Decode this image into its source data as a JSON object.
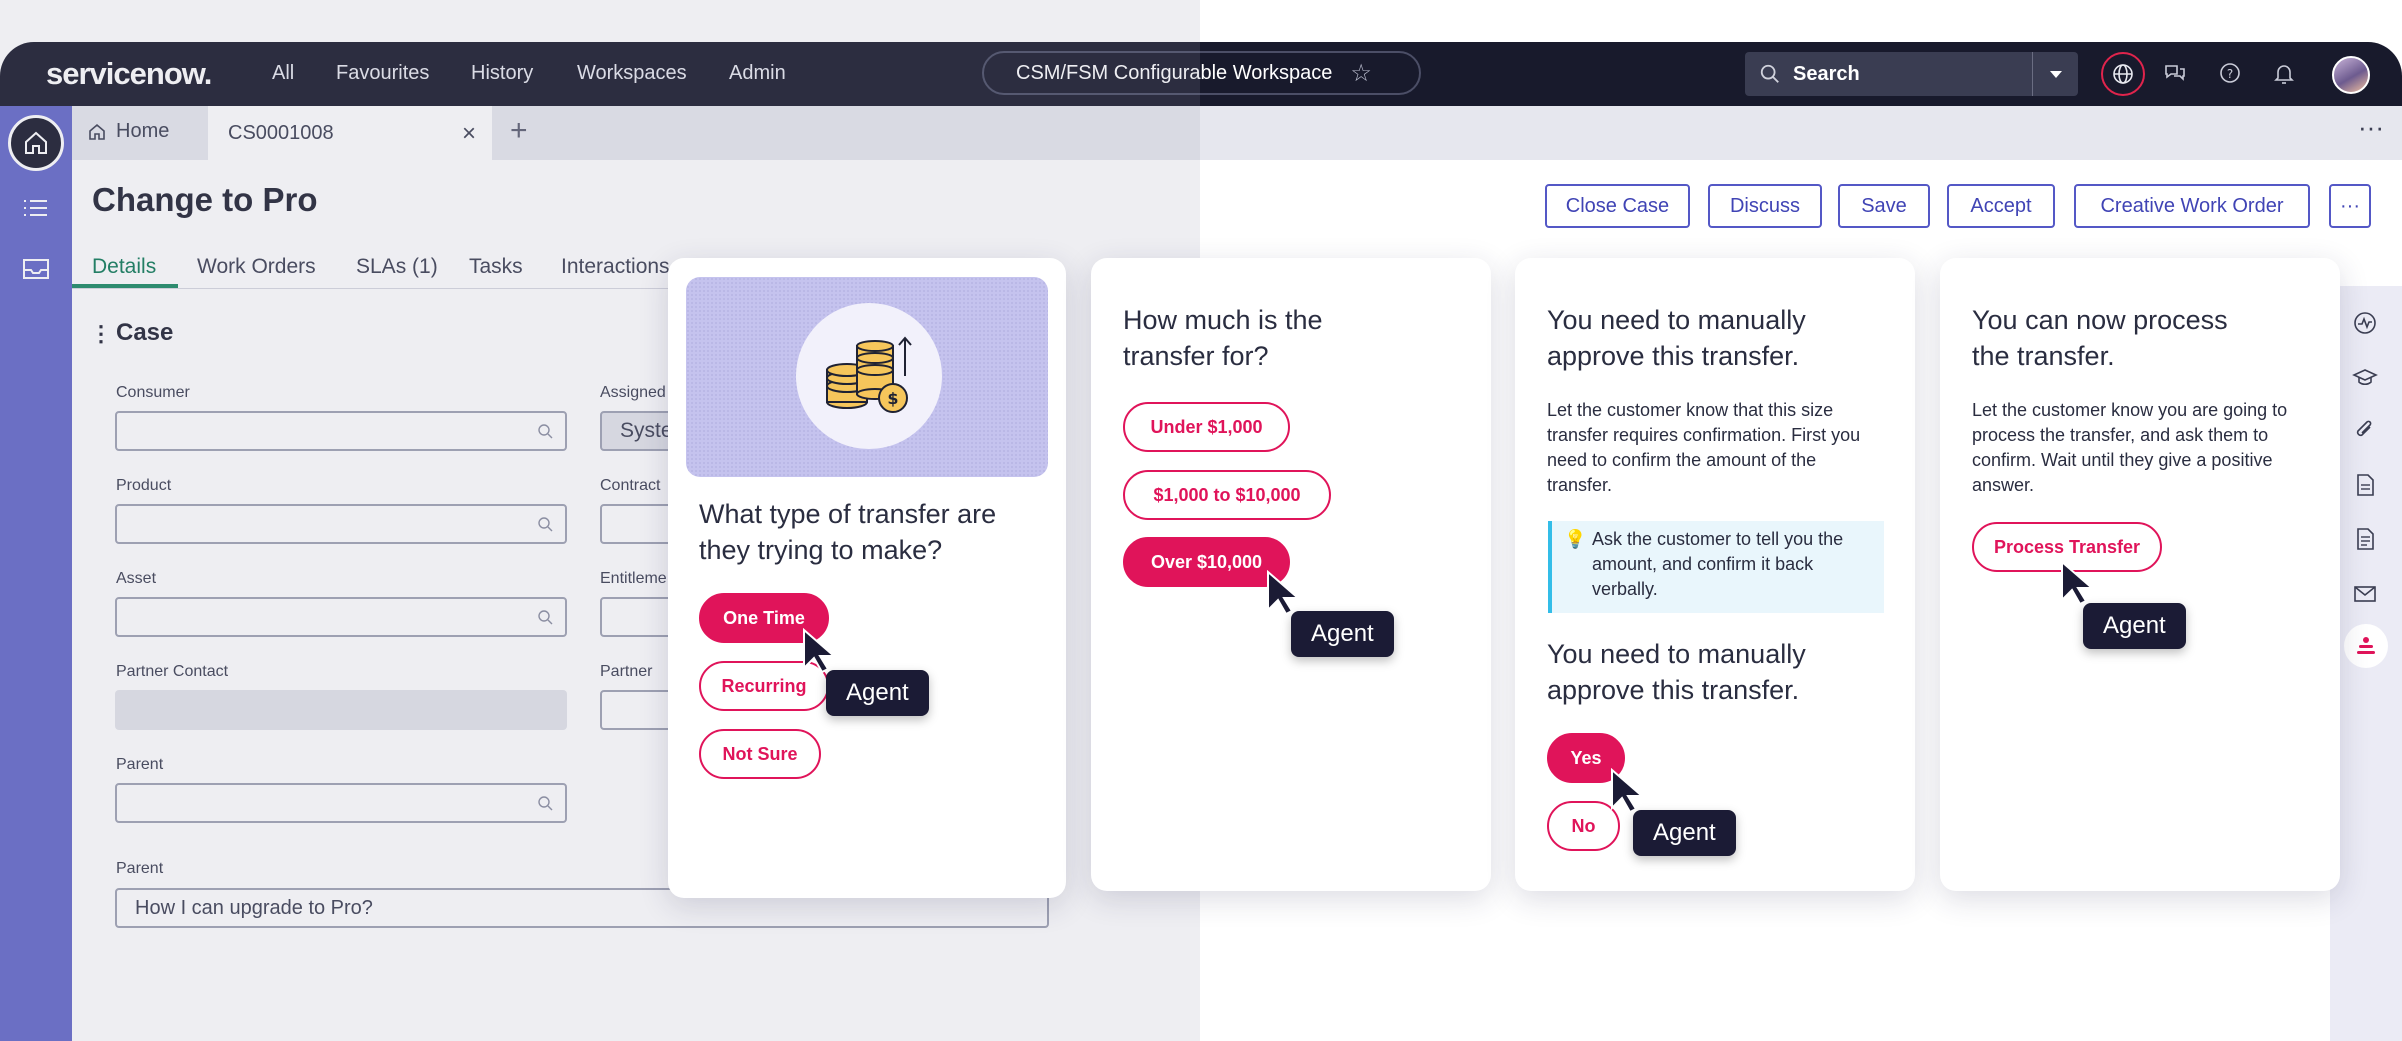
{
  "topnav": {
    "logo": "servicenow.",
    "items": [
      "All",
      "Favourites",
      "History",
      "Workspaces",
      "Admin"
    ],
    "workspace_title": "CSM/FSM Configurable Workspace",
    "search_label": "Search"
  },
  "tabs": {
    "home": "Home",
    "case": "CS0001008",
    "close": "×",
    "add": "+",
    "more": "···"
  },
  "record": {
    "title": "Change to Pro",
    "actions": [
      "Close Case",
      "Discuss",
      "Save",
      "Accept",
      "Creative Work Order"
    ],
    "more": "···",
    "subtabs": [
      "Details",
      "Work Orders",
      "SLAs (1)",
      "Tasks",
      "Interactions"
    ]
  },
  "form": {
    "section_title": "Case",
    "kebab": "⋮",
    "labels_left": [
      "Consumer",
      "Product",
      "Asset",
      "Partner Contact",
      "Parent"
    ],
    "labels_right": [
      "Assigned",
      "Contract",
      "Entitleme",
      "Partner"
    ],
    "assigned_value": "Syste",
    "parent2_label": "Parent",
    "parent2_value": "How I can upgrade to Pro?"
  },
  "card1": {
    "question": "What type of transfer are they trying to make?",
    "options": [
      "One Time",
      "Recurring",
      "Not Sure"
    ]
  },
  "card2": {
    "question": "How much is the transfer for?",
    "options": [
      "Under $1,000",
      "$1,000 to $10,000",
      "Over $10,000"
    ]
  },
  "card3": {
    "heading": "You need to manually approve this transfer.",
    "body": "Let the customer know that this size transfer requires confirmation. First you need to confirm the amount of the transfer.",
    "tip": "Ask the customer to tell you the amount, and confirm it back verbally.",
    "heading2": "You need to manually approve this transfer.",
    "options": [
      "Yes",
      "No"
    ]
  },
  "card4": {
    "heading": "You can now process the transfer.",
    "body": "Let the customer know you are going to process the transfer, and ask them to confirm. Wait until they give a positive answer.",
    "action": "Process Transfer"
  },
  "agent_label": "Agent",
  "colors": {
    "nav_bg": "#181a2c",
    "rail": "#6468c9",
    "accent_pink": "#e0145a",
    "action_blue": "#4044b5",
    "active_tab_green": "#0e7a57"
  }
}
